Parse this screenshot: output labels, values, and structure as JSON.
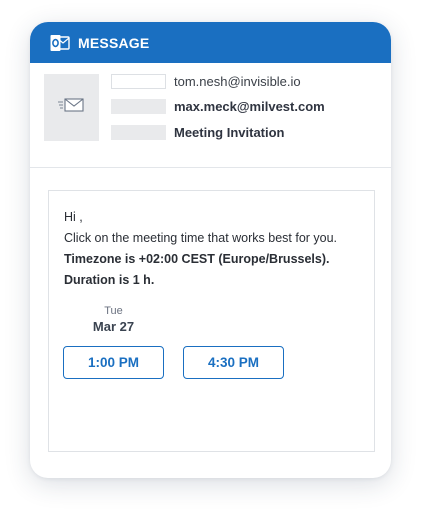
{
  "window": {
    "title": "MESSAGE",
    "icon": "outlook-icon",
    "accent_color": "#1a6fc1"
  },
  "header": {
    "from": "tom.nesh@invisible.io",
    "to": "max.meck@milvest.com",
    "subject": "Meeting Invitation",
    "avatar_icon": "envelope-icon"
  },
  "message": {
    "greeting": "Hi ,",
    "line1": "Click on the meeting time that works best for you.",
    "line2": "Timezone is +02:00 CEST (Europe/Brussels).",
    "line3": "Duration is 1 h."
  },
  "schedule": {
    "day_of_week": "Tue",
    "date": "Mar 27",
    "slots": [
      "1:00 PM",
      "4:30 PM"
    ]
  }
}
